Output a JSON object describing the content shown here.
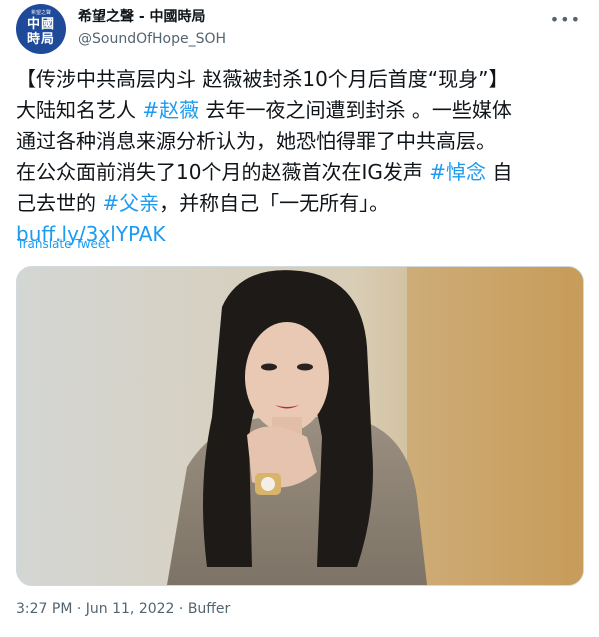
{
  "account": {
    "avatar_text_small": "希望之聲",
    "avatar_text_line1": "中國",
    "avatar_text_line2": "時局",
    "display_name": "希望之聲 - 中國時局",
    "handle": "@SoundOfHope_SOH"
  },
  "tweet": {
    "segments": [
      {
        "text": "【传涉中共高层内斗 赵薇被封杀10个月后首度“现身”】\n大陆知名艺人 ",
        "type": "text"
      },
      {
        "text": "#赵薇",
        "type": "link"
      },
      {
        "text": " 去年一夜之间遭到封杀 。一些媒体\n通过各种消息来源分析认为，她恐怕得罪了中共高层。\n在公众面前消失了10个月的赵薇首次在IG发声 ",
        "type": "text"
      },
      {
        "text": "#悼念",
        "type": "link"
      },
      {
        "text": " 自\n己去世的 ",
        "type": "text"
      },
      {
        "text": "#父亲",
        "type": "link"
      },
      {
        "text": "，并称自己「一无所有」。\n",
        "type": "text"
      },
      {
        "text": "buff.ly/3xlYPAK",
        "type": "link"
      }
    ],
    "translate_label": "Translate Tweet"
  },
  "meta": {
    "time": "3:27 PM",
    "date": "Jun 11, 2022",
    "source": "Buffer",
    "separator": "·"
  },
  "colors": {
    "link": "#1d9bf0",
    "secondary": "#536471",
    "avatar_bg": "#1f4a9a"
  },
  "icons": {
    "more": "more-horizontal-icon"
  }
}
